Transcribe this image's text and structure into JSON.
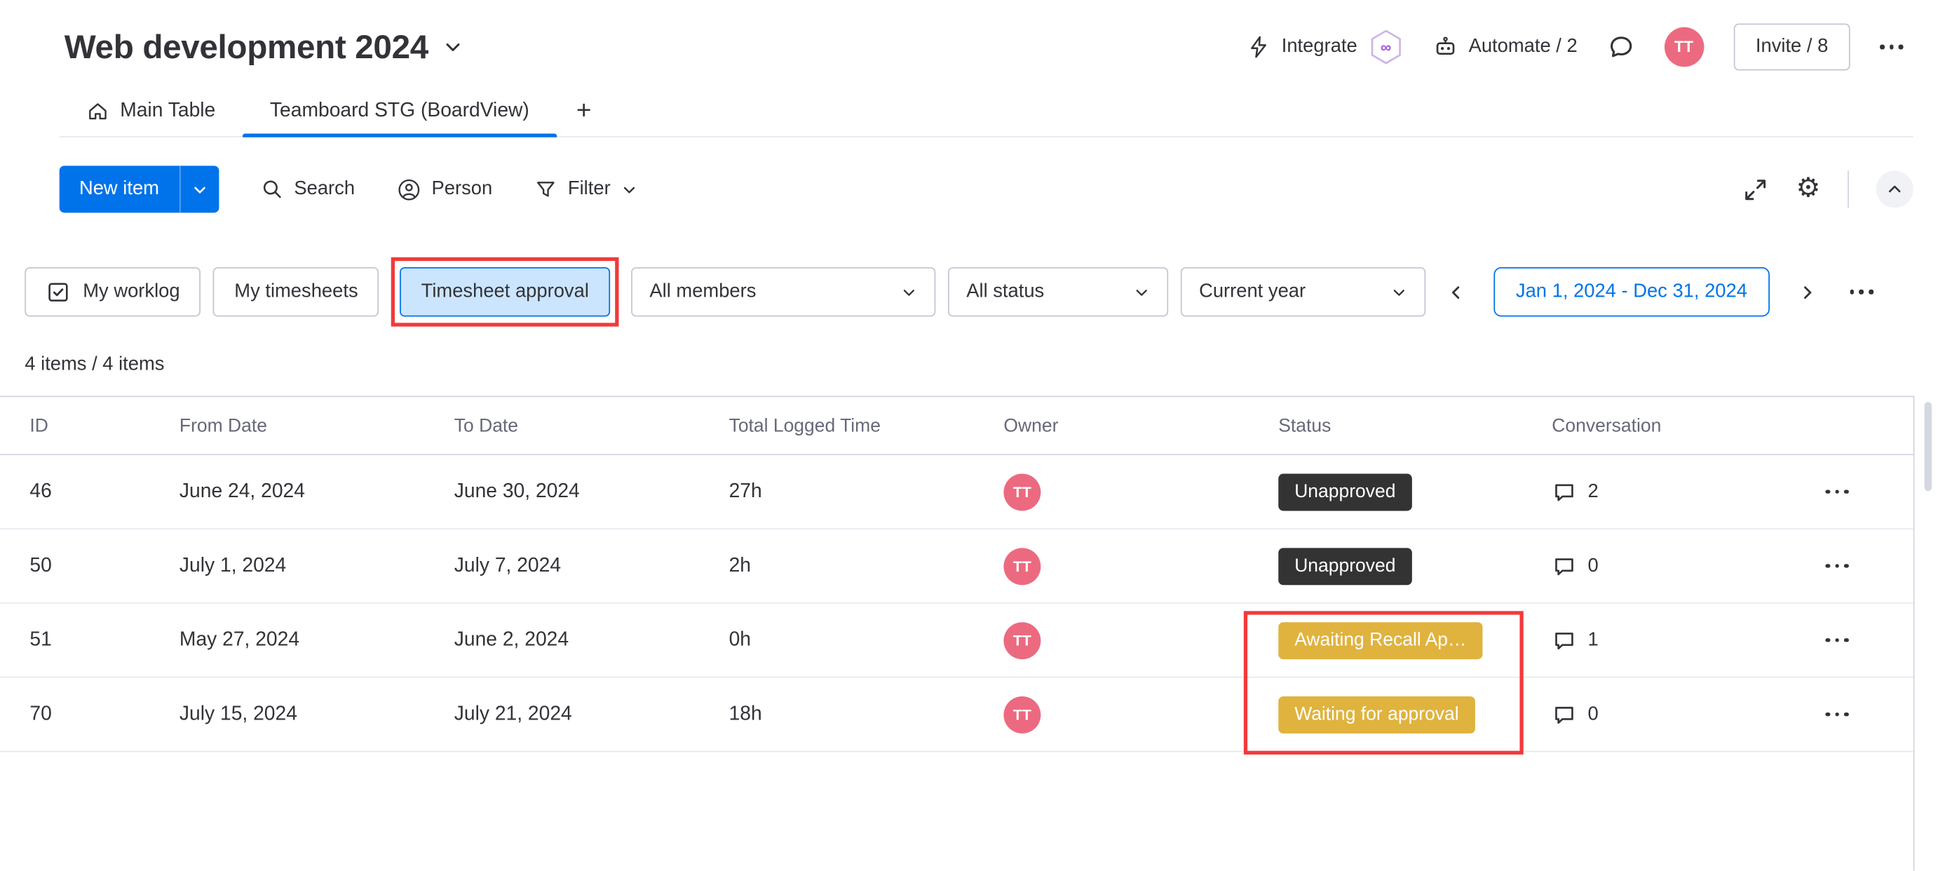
{
  "header": {
    "board_title": "Web development 2024",
    "integrate_label": "Integrate",
    "infinity_badge": "∞",
    "automate_label": "Automate / 2",
    "avatar_initials": "TT",
    "invite_label": "Invite / 8"
  },
  "tabs": {
    "main_table": "Main Table",
    "board_view": "Teamboard STG (BoardView)",
    "add_view": "+"
  },
  "toolbar": {
    "new_item_label": "New item",
    "search_label": "Search",
    "person_label": "Person",
    "filter_label": "Filter"
  },
  "filters": {
    "my_worklog_label": "My worklog",
    "my_timesheets_label": "My timesheets",
    "timesheet_approval_label": "Timesheet approval",
    "members_value": "All members",
    "status_value": "All status",
    "period_value": "Current year",
    "date_range_value": "Jan 1, 2024 - Dec 31, 2024"
  },
  "items_summary": "4 items / 4 items",
  "table": {
    "columns": [
      "ID",
      "From Date",
      "To Date",
      "Total Logged Time",
      "Owner",
      "Status",
      "Conversation"
    ],
    "rows": [
      {
        "id": "46",
        "from_date": "June 24, 2024",
        "to_date": "June 30, 2024",
        "total_logged_time": "27h",
        "owner_initials": "TT",
        "status": "Unapproved",
        "status_color": "dark",
        "conversation_count": "2"
      },
      {
        "id": "50",
        "from_date": "July 1, 2024",
        "to_date": "July 7, 2024",
        "total_logged_time": "2h",
        "owner_initials": "TT",
        "status": "Unapproved",
        "status_color": "dark",
        "conversation_count": "0"
      },
      {
        "id": "51",
        "from_date": "May 27, 2024",
        "to_date": "June 2, 2024",
        "total_logged_time": "0h",
        "owner_initials": "TT",
        "status": "Awaiting Recall Ap…",
        "status_color": "yellow",
        "conversation_count": "1"
      },
      {
        "id": "70",
        "from_date": "July 15, 2024",
        "to_date": "July 21, 2024",
        "total_logged_time": "18h",
        "owner_initials": "TT",
        "status": "Waiting for approval",
        "status_color": "yellow",
        "conversation_count": "0"
      }
    ]
  },
  "colors": {
    "accent_blue": "#0073ea",
    "selected_chip_bg": "#cce5ff",
    "status_dark": "#333333",
    "status_yellow": "#e0b33e",
    "avatar_pink": "#ec6a80",
    "annotation_red": "#f23a3a"
  }
}
